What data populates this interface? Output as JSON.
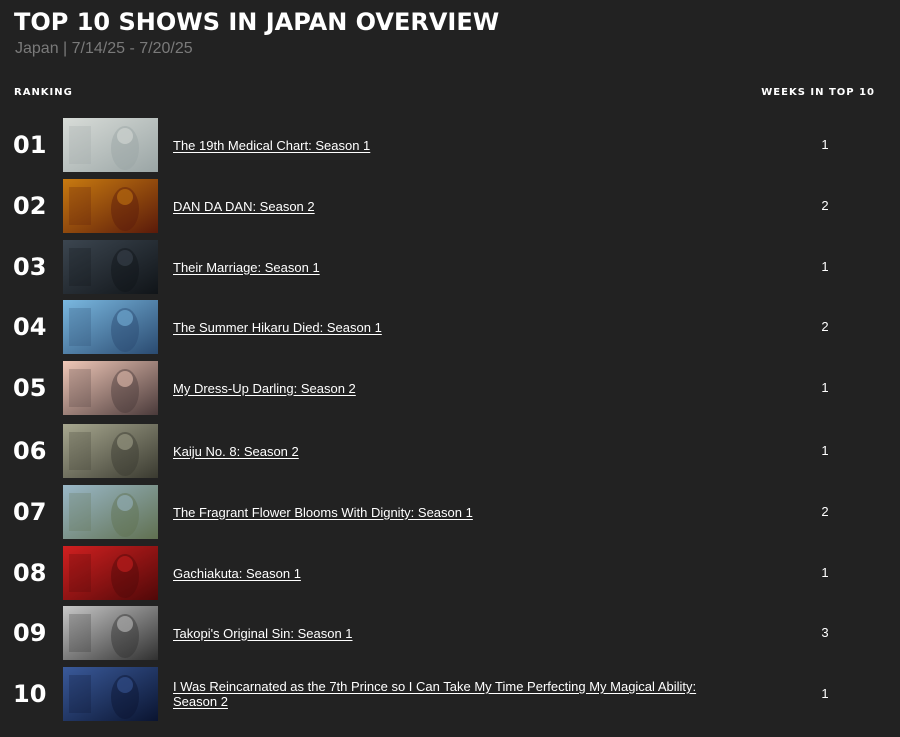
{
  "header": {
    "title": "TOP 10 SHOWS IN JAPAN OVERVIEW",
    "subtitle": "Japan | 7/14/25 - 7/20/25"
  },
  "table": {
    "col_ranking": "RANKING",
    "col_weeks": "WEEKS IN TOP 10",
    "rows": [
      {
        "rank": "01",
        "title": "The 19th Medical Chart: Season 1",
        "weeks": "1",
        "thumb_icon": "medical-drama-poster",
        "thumb_colors": [
          "#d8dcd8",
          "#9aa5a5"
        ]
      },
      {
        "rank": "02",
        "title": "DAN DA DAN: Season 2",
        "weeks": "2",
        "thumb_icon": "anime-poster",
        "thumb_colors": [
          "#c87a10",
          "#5a1a0a"
        ]
      },
      {
        "rank": "03",
        "title": "Their Marriage: Season 1",
        "weeks": "1",
        "thumb_icon": "drama-poster",
        "thumb_colors": [
          "#3c4650",
          "#101418"
        ]
      },
      {
        "rank": "04",
        "title": "The Summer Hikaru Died: Season 1",
        "weeks": "2",
        "thumb_icon": "anime-poster",
        "thumb_colors": [
          "#7ab8e0",
          "#2a4a70"
        ]
      },
      {
        "rank": "05",
        "title": "My Dress-Up Darling: Season 2",
        "weeks": "1",
        "thumb_icon": "anime-poster",
        "thumb_colors": [
          "#f0c8b8",
          "#4a3a3a"
        ]
      },
      {
        "rank": "06",
        "title": "Kaiju No. 8: Season 2",
        "weeks": "1",
        "thumb_icon": "anime-poster",
        "thumb_colors": [
          "#a8a890",
          "#3a3a30"
        ]
      },
      {
        "rank": "07",
        "title": "The Fragrant Flower Blooms With Dignity: Season 1",
        "weeks": "2",
        "thumb_icon": "anime-poster",
        "thumb_colors": [
          "#9ab8c8",
          "#607050"
        ]
      },
      {
        "rank": "08",
        "title": "Gachiakuta: Season 1",
        "weeks": "1",
        "thumb_icon": "anime-poster",
        "thumb_colors": [
          "#d02020",
          "#500808"
        ]
      },
      {
        "rank": "09",
        "title": "Takopi's Original Sin: Season 1",
        "weeks": "3",
        "thumb_icon": "anime-poster",
        "thumb_colors": [
          "#c8c8c8",
          "#303030"
        ]
      },
      {
        "rank": "10",
        "title": "I Was Reincarnated as the 7th Prince so I Can Take My Time Perfecting My Magical Ability: Season 2",
        "weeks": "1",
        "thumb_icon": "anime-poster",
        "thumb_colors": [
          "#3a5a9a",
          "#0a1430"
        ]
      }
    ]
  }
}
